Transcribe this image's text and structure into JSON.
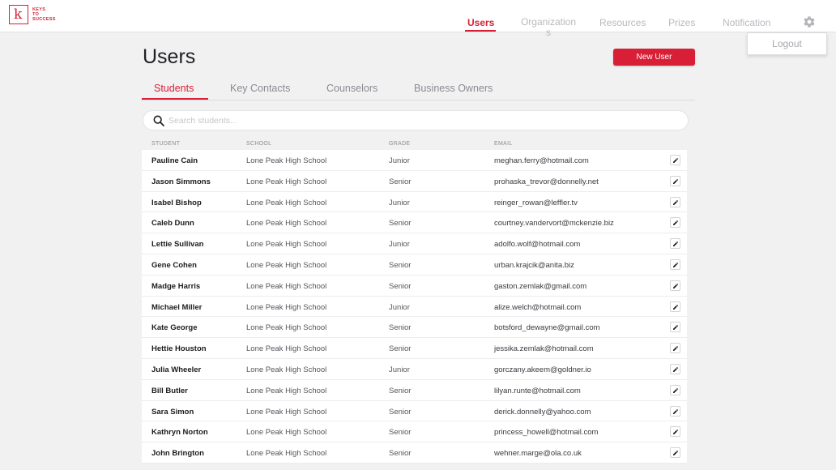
{
  "brand": {
    "logo_letter": "k",
    "logo_lines": [
      "KEYS",
      "TO",
      "SUCCESS"
    ]
  },
  "nav": {
    "items": [
      "Users",
      "Organizations",
      "Resources",
      "Prizes",
      "Notification"
    ],
    "active": "Users"
  },
  "settings": {
    "icon": "gear-icon",
    "menu_item": "Logout"
  },
  "page": {
    "title": "Users",
    "new_user_label": "New User"
  },
  "tabs": {
    "items": [
      "Students",
      "Key Contacts",
      "Counselors",
      "Business Owners"
    ],
    "active": "Students"
  },
  "search": {
    "placeholder": "Search students...",
    "value": ""
  },
  "table": {
    "headers": [
      "STUDENT",
      "SCHOOL",
      "GRADE",
      "EMAIL"
    ],
    "rows": [
      {
        "name": "Pauline Cain",
        "school": "Lone Peak High School",
        "grade": "Junior",
        "email": "meghan.ferry@hotmail.com"
      },
      {
        "name": "Jason Simmons",
        "school": "Lone Peak High School",
        "grade": "Senior",
        "email": "prohaska_trevor@donnelly.net"
      },
      {
        "name": "Isabel Bishop",
        "school": "Lone Peak High School",
        "grade": "Junior",
        "email": "reinger_rowan@leffler.tv"
      },
      {
        "name": "Caleb Dunn",
        "school": "Lone Peak High School",
        "grade": "Senior",
        "email": "courtney.vandervort@mckenzie.biz"
      },
      {
        "name": "Lettie Sullivan",
        "school": "Lone Peak High School",
        "grade": "Junior",
        "email": "adolfo.wolf@hotmail.com"
      },
      {
        "name": "Gene Cohen",
        "school": "Lone Peak High School",
        "grade": "Senior",
        "email": "urban.krajcik@anita.biz"
      },
      {
        "name": "Madge Harris",
        "school": "Lone Peak High School",
        "grade": "Senior",
        "email": "gaston.zemlak@gmail.com"
      },
      {
        "name": "Michael Miller",
        "school": "Lone Peak High School",
        "grade": "Junior",
        "email": "alize.welch@hotmail.com"
      },
      {
        "name": "Kate George",
        "school": "Lone Peak High School",
        "grade": "Senior",
        "email": "botsford_dewayne@gmail.com"
      },
      {
        "name": "Hettie Houston",
        "school": "Lone Peak High School",
        "grade": "Senior",
        "email": "jessika.zemlak@hotmail.com"
      },
      {
        "name": "Julia Wheeler",
        "school": "Lone Peak High School",
        "grade": "Junior",
        "email": "gorczany.akeem@goldner.io"
      },
      {
        "name": "Bill Butler",
        "school": "Lone Peak High School",
        "grade": "Senior",
        "email": "lilyan.runte@hotmail.com"
      },
      {
        "name": "Sara Simon",
        "school": "Lone Peak High School",
        "grade": "Senior",
        "email": "derick.donnelly@yahoo.com"
      },
      {
        "name": "Kathryn Norton",
        "school": "Lone Peak High School",
        "grade": "Senior",
        "email": "princess_howell@hotmail.com"
      },
      {
        "name": "John Brington",
        "school": "Lone Peak High School",
        "grade": "Senior",
        "email": "wehner.marge@ola.co.uk"
      }
    ]
  },
  "colors": {
    "accent": "#d81f36",
    "background": "#f1f1f2",
    "muted": "#b9b9bf"
  }
}
